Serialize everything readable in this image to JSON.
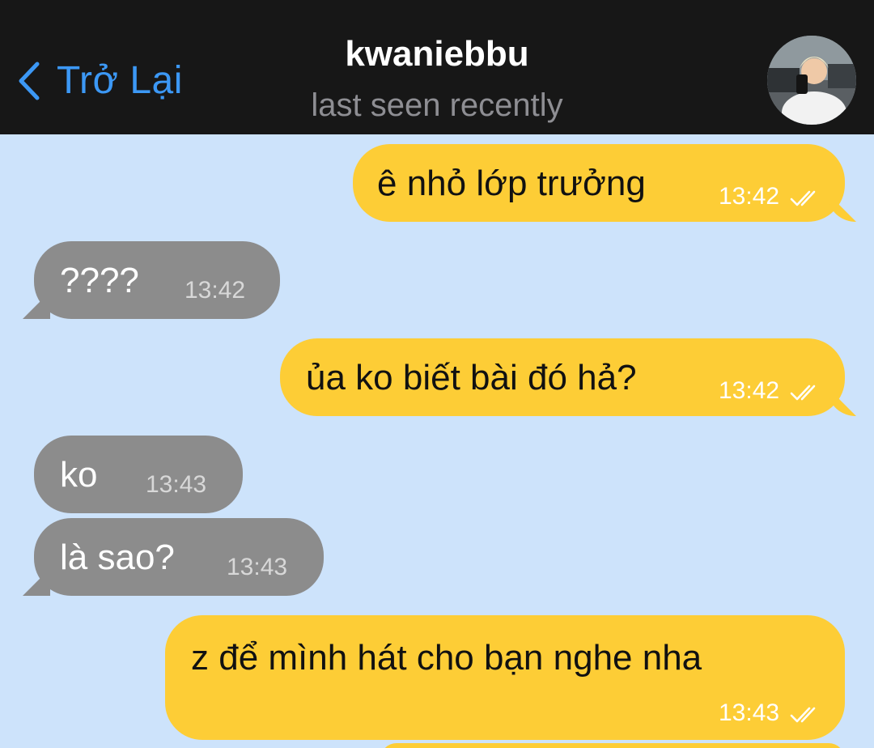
{
  "header": {
    "back_label": "Trở Lại",
    "contact_name": "kwaniebbu",
    "status": "last seen recently"
  },
  "messages": [
    {
      "direction": "out",
      "text": "ê nhỏ lớp trưởng",
      "time": "13:42",
      "read": true
    },
    {
      "direction": "in",
      "text": "????",
      "time": "13:42"
    },
    {
      "direction": "out",
      "text": "ủa ko biết bài đó hả?",
      "time": "13:42",
      "read": true
    },
    {
      "direction": "in",
      "text": "ko",
      "time": "13:43"
    },
    {
      "direction": "in",
      "text": "là sao?",
      "time": "13:43"
    },
    {
      "direction": "out",
      "text": "z để mình hát cho bạn nghe nha",
      "time": "13:43",
      "read": true
    }
  ],
  "colors": {
    "header_bg": "#171717",
    "accent": "#3c98f5",
    "chat_bg": "#cde3fb",
    "outgoing_bubble": "#fdcd36",
    "incoming_bubble": "#8c8c8c"
  },
  "icons": {
    "back": "chevron-left-icon",
    "read_receipt": "double-check-icon"
  }
}
